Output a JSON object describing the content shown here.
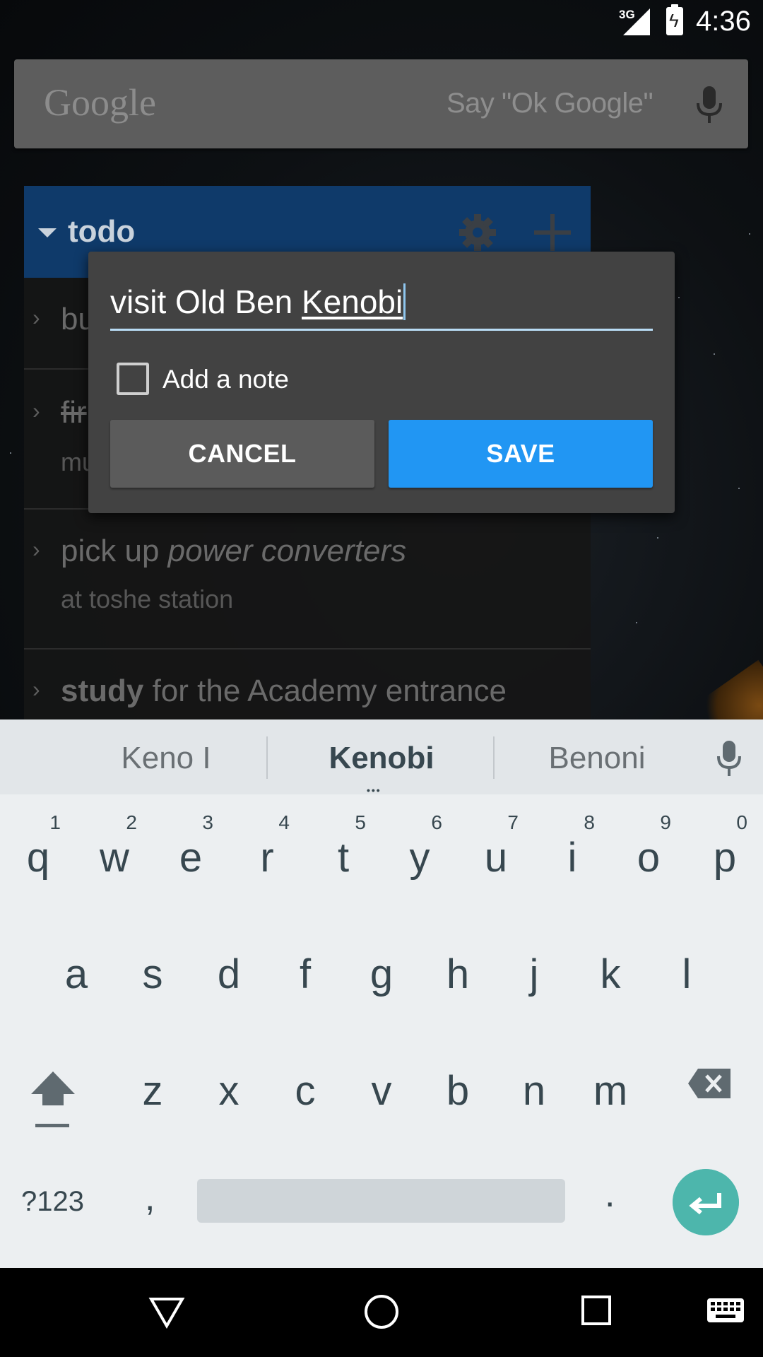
{
  "status_bar": {
    "network": "3G",
    "time": "4:36"
  },
  "google_bar": {
    "logo": "Google",
    "hint": "Say \"Ok Google\"",
    "mic_icon": "mic-icon"
  },
  "widget": {
    "title": "todo",
    "items": [
      {
        "main_visible": "bu",
        "sub": ""
      },
      {
        "main_visible": "fir",
        "sub": "mu",
        "completed": true
      },
      {
        "main_prefix": "pick up ",
        "main_em": "power converters",
        "sub": "at toshe station"
      },
      {
        "main_bold": "study",
        "main_rest": " for the Academy entrance",
        "sub": ""
      }
    ]
  },
  "dialog": {
    "input_value": "visit Old Ben ",
    "input_composing": "Kenobi",
    "checkbox_label": "Add a note",
    "checkbox_checked": false,
    "cancel_label": "CANCEL",
    "save_label": "SAVE",
    "save_color": "#2196f3"
  },
  "keyboard": {
    "suggestions": [
      "Keno I",
      "Kenobi",
      "Benoni"
    ],
    "suggestion_more": "•••",
    "row1": [
      "q",
      "w",
      "e",
      "r",
      "t",
      "y",
      "u",
      "i",
      "o",
      "p"
    ],
    "row1_hints": [
      "1",
      "2",
      "3",
      "4",
      "5",
      "6",
      "7",
      "8",
      "9",
      "0"
    ],
    "row2": [
      "a",
      "s",
      "d",
      "f",
      "g",
      "h",
      "j",
      "k",
      "l"
    ],
    "row3": [
      "z",
      "x",
      "c",
      "v",
      "b",
      "n",
      "m"
    ],
    "symbols_label": "?123",
    "comma": ",",
    "period": ".",
    "enter_color": "#4db6ac"
  }
}
